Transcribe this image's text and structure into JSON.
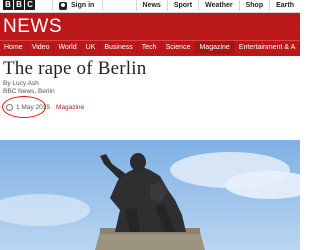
{
  "topbar": {
    "logo": [
      "B",
      "B",
      "C"
    ],
    "signin_label": "Sign in",
    "nav": [
      "News",
      "Sport",
      "Weather",
      "Shop",
      "Earth"
    ]
  },
  "header": {
    "title": "NEWS"
  },
  "mainnav": {
    "items": [
      "Home",
      "Video",
      "World",
      "UK",
      "Business",
      "Tech",
      "Science",
      "Magazine",
      "Entertainment & A"
    ],
    "active": "Magazine"
  },
  "article": {
    "headline": "The rape of Berlin",
    "author": "By Lucy Ash",
    "location": "BBC News, Berlin",
    "date": "1 May 2015",
    "section": "Magazine"
  },
  "colors": {
    "brand_red": "#bb1919",
    "highlight_circle": "#dd1111"
  }
}
